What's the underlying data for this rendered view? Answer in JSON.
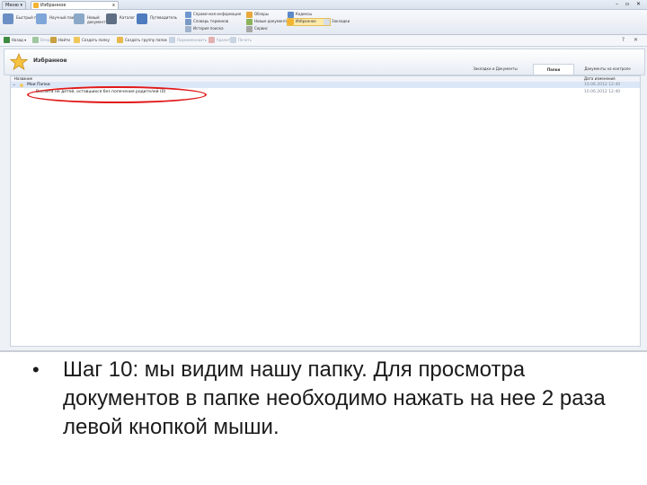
{
  "window": {
    "menu_label": "Меню ▾",
    "tab_label": "Избранное",
    "tab_close": "x",
    "controls": "– ▫ ✕"
  },
  "ribbon": {
    "big_buttons": [
      {
        "label": "Быстрый поиск"
      },
      {
        "label": "Научный поиск"
      },
      {
        "label": "Новый документ"
      },
      {
        "label": "Каталог"
      },
      {
        "label": "Путеводитель"
      }
    ],
    "small_buttons": [
      {
        "label": "Справочная информация"
      },
      {
        "label": "Обзоры"
      },
      {
        "label": "Кодексы"
      },
      {
        "label": "Словарь терминов"
      },
      {
        "label": "Новые документы"
      },
      {
        "label": "Избранное"
      },
      {
        "label": "Закладки"
      },
      {
        "label": "История поиска"
      },
      {
        "label": "Сервис"
      }
    ]
  },
  "toolbar": {
    "items": [
      {
        "label": "Назад ▾"
      },
      {
        "label": "Вперёд ▾"
      },
      {
        "label": "Найти"
      },
      {
        "label": "Создать папку"
      },
      {
        "label": "Создать группу папок"
      },
      {
        "label": "Переименовать"
      },
      {
        "label": "Удалить"
      },
      {
        "label": "Печать"
      }
    ],
    "right": "? ✕"
  },
  "header": {
    "title": "Избранное",
    "tabs": [
      {
        "label": "Закладки и Документы"
      },
      {
        "label": "Папки"
      },
      {
        "label": "Документы на контроле"
      }
    ]
  },
  "grid": {
    "columns": {
      "name": "Название",
      "date": "Дата изменения"
    },
    "rows": [
      {
        "name": "Мои Папки",
        "date": "10.06.2012 12:40"
      },
      {
        "name": "Воспита не детей, оставшихся без попечения родителей (0)",
        "date": "10.06.2012 12:40"
      }
    ]
  },
  "colors": {
    "highlight": "#e11818",
    "selected_row": "#dbe6f7"
  },
  "caption": {
    "bullet": "•",
    "text": "Шаг 10: мы видим нашу папку. Для просмотра документов в папке необходимо нажать на нее 2 раза левой кнопкой мыши."
  }
}
